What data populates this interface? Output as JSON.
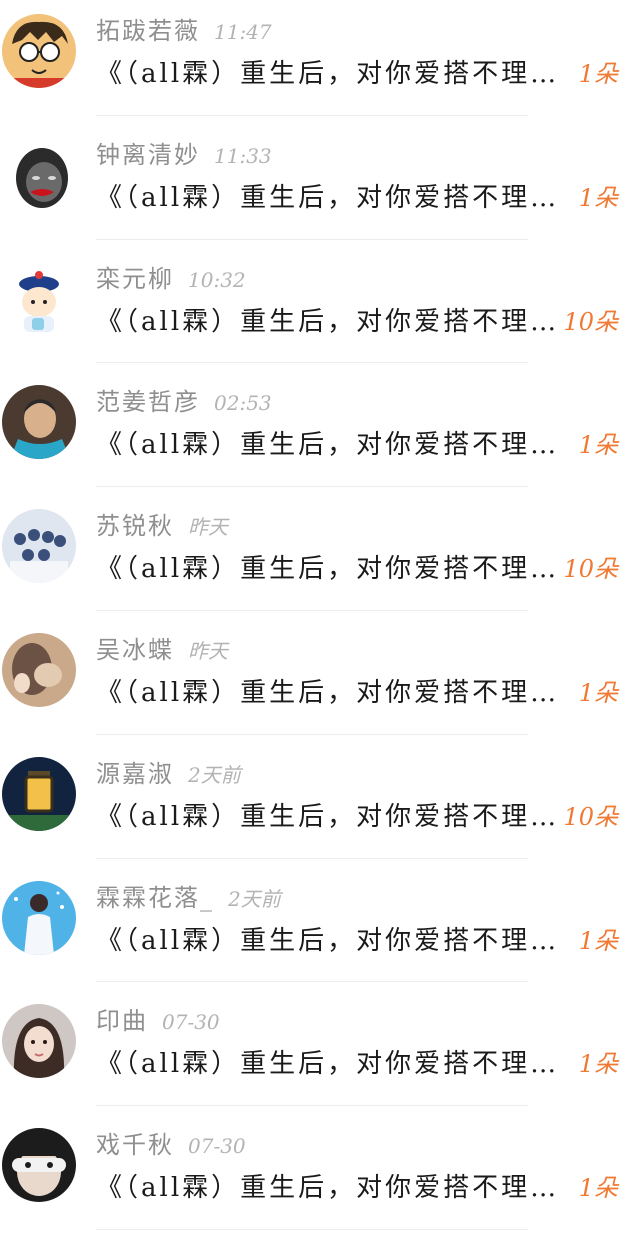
{
  "items": [
    {
      "name": "拓跋若薇",
      "time": "11:47",
      "message": "《（all霖）重生后，对你爱搭不理》",
      "gift": "1朵",
      "avatar_icon": "cartoon-glasses-boy-avatar",
      "avatar_colors": [
        "#f2c27b",
        "#3a2a1a"
      ]
    },
    {
      "name": "钟离清妙",
      "time": "11:33",
      "message": "《（all霖）重生后，对你爱搭不理》",
      "gift": "1朵",
      "avatar_icon": "bw-face-red-lips-avatar",
      "avatar_colors": [
        "#d9d9d9",
        "#2b2b2b"
      ]
    },
    {
      "name": "栾元柳",
      "time": "10:32",
      "message": "《（all霖）重生后，对你爱搭不理》",
      "gift": "10朵",
      "avatar_icon": "cartoon-qing-official-avatar",
      "avatar_colors": [
        "#e8f0fb",
        "#1f3f8a"
      ]
    },
    {
      "name": "范姜哲彦",
      "time": "02:53",
      "message": "《（all霖）重生后，对你爱搭不理》",
      "gift": "1朵",
      "avatar_icon": "elderly-woman-photo-avatar",
      "avatar_colors": [
        "#4a3a2f",
        "#2aa6c9"
      ]
    },
    {
      "name": "苏锐秋",
      "time": "昨天",
      "message": "《（all霖）重生后，对你爱搭不理》",
      "gift": "10朵",
      "avatar_icon": "group-photo-avatar",
      "avatar_colors": [
        "#dfe6ef",
        "#3a4f7a"
      ]
    },
    {
      "name": "吴冰蝶",
      "time": "昨天",
      "message": "《（all霖）重生后，对你爱搭不理》",
      "gift": "1朵",
      "avatar_icon": "girl-with-cat-photo-avatar",
      "avatar_colors": [
        "#6b5244",
        "#caa98a"
      ]
    },
    {
      "name": "源嘉淑",
      "time": "2天前",
      "message": "《（all霖）重生后，对你爱搭不理》",
      "gift": "10朵",
      "avatar_icon": "lantern-night-photo-avatar",
      "avatar_colors": [
        "#12233f",
        "#f3c04a"
      ]
    },
    {
      "name": "霖霖花落_",
      "time": "2天前",
      "message": "《（all霖）重生后，对你爱搭不理》",
      "gift": "1朵",
      "avatar_icon": "stage-performer-photo-avatar",
      "avatar_colors": [
        "#4fb3e8",
        "#f4f7fb"
      ]
    },
    {
      "name": "印曲",
      "time": "07-30",
      "message": "《（all霖）重生后，对你爱搭不理》",
      "gift": "1朵",
      "avatar_icon": "girl-portrait-photo-avatar",
      "avatar_colors": [
        "#cfc7c4",
        "#3d2b26"
      ]
    },
    {
      "name": "戏千秋",
      "time": "07-30",
      "message": "《（all霖）重生后，对你爱搭不理》",
      "gift": "1朵",
      "avatar_icon": "boy-eye-mask-photo-avatar",
      "avatar_colors": [
        "#1c1c1c",
        "#f2f2f2"
      ]
    }
  ]
}
